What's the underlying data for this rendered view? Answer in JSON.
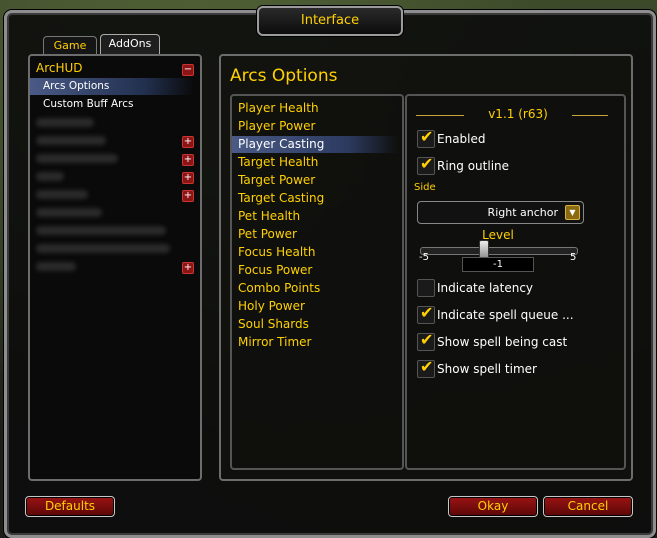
{
  "window": {
    "title": "Interface"
  },
  "tabs": [
    {
      "label": "Game"
    },
    {
      "label": "AddOns"
    }
  ],
  "addon_tree": {
    "root_label": "ArcHUD",
    "root_toggle": "−",
    "children": [
      {
        "label": "Arcs Options"
      },
      {
        "label": "Custom Buff Arcs"
      }
    ],
    "expand_glyph": "+"
  },
  "panel": {
    "title": "Arcs Options",
    "arcs": [
      "Player Health",
      "Player Power",
      "Player Casting",
      "Target Health",
      "Target Power",
      "Target Casting",
      "Pet Health",
      "Pet Power",
      "Focus Health",
      "Focus Power",
      "Combo Points",
      "Holy Power",
      "Soul Shards",
      "Mirror Timer"
    ],
    "selected_arc": "Player Casting"
  },
  "options": {
    "version": "v1.1 (r63)",
    "enabled": {
      "label": "Enabled",
      "checked": true
    },
    "ring_outline": {
      "label": "Ring outline",
      "checked": true
    },
    "side": {
      "label": "Side",
      "value": "Right anchor"
    },
    "level": {
      "label": "Level",
      "min": "-5",
      "max": "5",
      "value": "-1"
    },
    "indicate_latency": {
      "label": "Indicate latency",
      "checked": false
    },
    "indicate_spell_queue": {
      "label": "Indicate spell queue ...",
      "checked": true
    },
    "show_spell_being_cast": {
      "label": "Show spell being cast",
      "checked": true
    },
    "show_spell_timer": {
      "label": "Show spell timer",
      "checked": true
    }
  },
  "check_glyph": "✔",
  "dropdown_glyph": "▼",
  "buttons": {
    "defaults": "Defaults",
    "okay": "Okay",
    "cancel": "Cancel"
  },
  "colors": {
    "accent_gold": "#ffd100",
    "button_red": "#9a1414",
    "selection_blue": "#4a5a86"
  }
}
